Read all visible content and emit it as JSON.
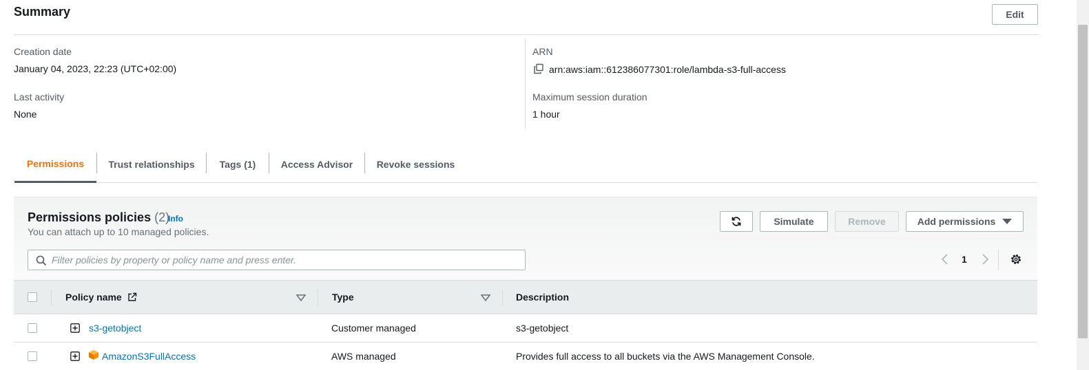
{
  "summary": {
    "title": "Summary",
    "edit_label": "Edit",
    "creation_date_label": "Creation date",
    "creation_date_value": "January 04, 2023, 22:23 (UTC+02:00)",
    "last_activity_label": "Last activity",
    "last_activity_value": "None",
    "arn_label": "ARN",
    "arn_value": "arn:aws:iam::612386077301:role/lambda-s3-full-access",
    "max_session_label": "Maximum session duration",
    "max_session_value": "1 hour"
  },
  "tabs": [
    {
      "label": "Permissions",
      "active": true
    },
    {
      "label": "Trust relationships",
      "active": false
    },
    {
      "label": "Tags (1)",
      "active": false
    },
    {
      "label": "Access Advisor",
      "active": false
    },
    {
      "label": "Revoke sessions",
      "active": false
    }
  ],
  "permissions": {
    "title": "Permissions policies",
    "count": "(2)",
    "info_label": "Info",
    "subtitle": "You can attach up to 10 managed policies.",
    "simulate_label": "Simulate",
    "remove_label": "Remove",
    "add_permissions_label": "Add permissions",
    "search_placeholder": "Filter policies by property or policy name and press enter.",
    "page_number": "1",
    "columns": [
      "Policy name",
      "Type",
      "Description"
    ],
    "rows": [
      {
        "name": "s3-getobject",
        "type": "Customer managed",
        "description": "s3-getobject",
        "aws_managed": false
      },
      {
        "name": "AmazonS3FullAccess",
        "type": "AWS managed",
        "description": "Provides full access to all buckets via the AWS Management Console.",
        "aws_managed": true
      }
    ]
  },
  "colors": {
    "accent": "#ec7211",
    "link": "#0073bb",
    "text": "#16191f",
    "muted": "#545b64"
  }
}
